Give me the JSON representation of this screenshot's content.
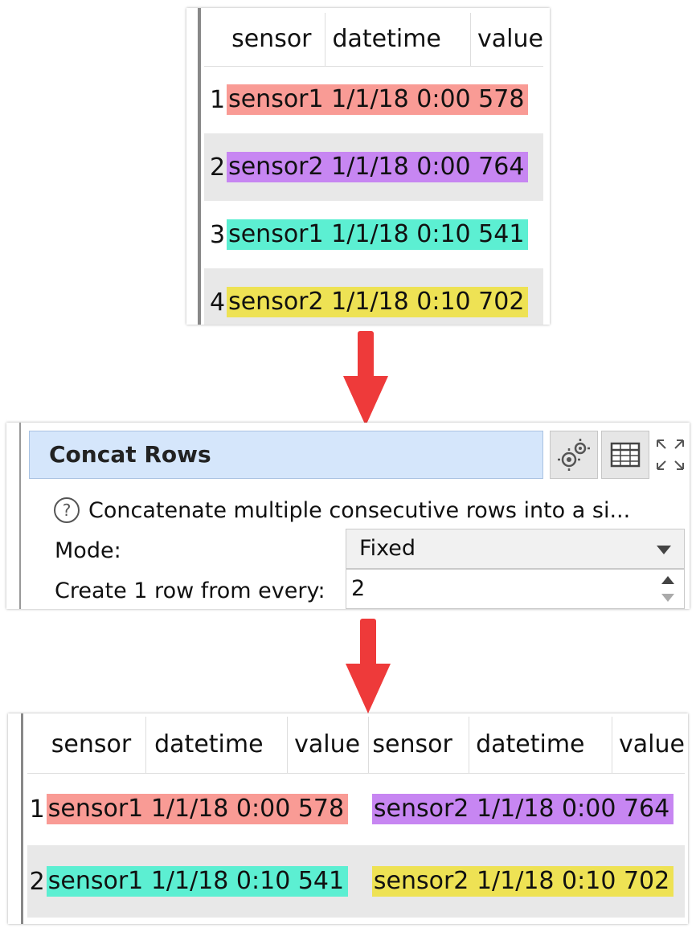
{
  "input_table": {
    "headers": [
      "sensor",
      "datetime",
      "value"
    ],
    "rows": [
      {
        "num": "1",
        "sensor": "sensor1",
        "datetime": "1/1/18 0:00",
        "value": "578"
      },
      {
        "num": "2",
        "sensor": "sensor2",
        "datetime": "1/1/18 0:00",
        "value": "764"
      },
      {
        "num": "3",
        "sensor": "sensor1",
        "datetime": "1/1/18 0:10",
        "value": "541"
      },
      {
        "num": "4",
        "sensor": "sensor2",
        "datetime": "1/1/18 0:10",
        "value": "702"
      }
    ]
  },
  "concat_panel": {
    "title": "Concat Rows",
    "description": "Concatenate multiple consecutive rows into a si...",
    "mode_label": "Mode:",
    "mode_value": "Fixed",
    "create_label": "Create 1 row from every:",
    "create_value": "2",
    "icons": [
      "gears-icon",
      "table-icon",
      "maximize-icon",
      "help-icon"
    ]
  },
  "output_table": {
    "headers": [
      "sensor",
      "datetime",
      "value",
      "sensor",
      "datetime",
      "value"
    ],
    "rows": [
      {
        "num": "1",
        "a_sensor": "sensor1",
        "a_datetime": "1/1/18 0:00",
        "a_value": "578",
        "b_sensor": "sensor2",
        "b_datetime": "1/1/18 0:00",
        "b_value": "764"
      },
      {
        "num": "2",
        "a_sensor": "sensor1",
        "a_datetime": "1/1/18 0:10",
        "a_value": "541",
        "b_sensor": "sensor2",
        "b_datetime": "1/1/18 0:10",
        "b_value": "702"
      }
    ]
  },
  "colors": {
    "red_highlight": "#f99b95",
    "purple_highlight": "#c786f2",
    "teal_highlight": "#5cefd2",
    "yellow_highlight": "#eee254",
    "arrow": "#ee3a3a",
    "title_background": "#d5e6fb",
    "alt_row": "#e8e8e8"
  }
}
